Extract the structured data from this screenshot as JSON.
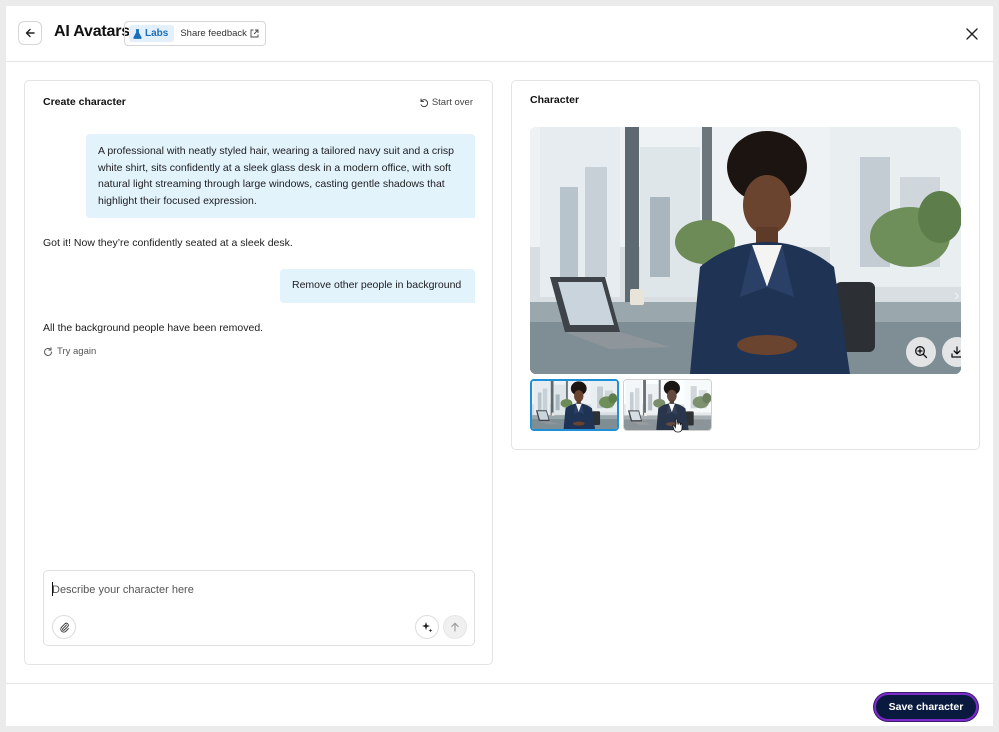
{
  "header": {
    "title": "AI Avatars",
    "labs_label": "Labs",
    "share_feedback": "Share feedback",
    "back_icon": "arrow-left-icon",
    "close_icon": "close-icon"
  },
  "left_panel": {
    "title": "Create character",
    "start_over": "Start over",
    "messages": [
      {
        "role": "user",
        "text": "A professional with neatly styled hair, wearing a tailored navy suit and a crisp white shirt, sits confidently at a sleek glass desk in a modern office, with soft natural light streaming through large windows, casting gentle shadows that highlight their focused expression."
      },
      {
        "role": "assistant",
        "text": "Got it! Now they’re confidently seated at a sleek desk."
      },
      {
        "role": "user",
        "text": "Remove other people in background"
      },
      {
        "role": "assistant",
        "text": "All the background people have been removed."
      }
    ],
    "try_again": "Try again",
    "composer": {
      "placeholder": "Describe your character here",
      "value": ""
    }
  },
  "right_panel": {
    "title": "Character",
    "selected_thumbnail": 1,
    "thumbnail_count": 2
  },
  "footer": {
    "save_label": "Save character"
  },
  "colors": {
    "user_bubble": "#e2f3fc",
    "accent_blue": "#1f8fd6",
    "save_button": "#0a1a3f",
    "save_border": "#7b2cc9"
  }
}
